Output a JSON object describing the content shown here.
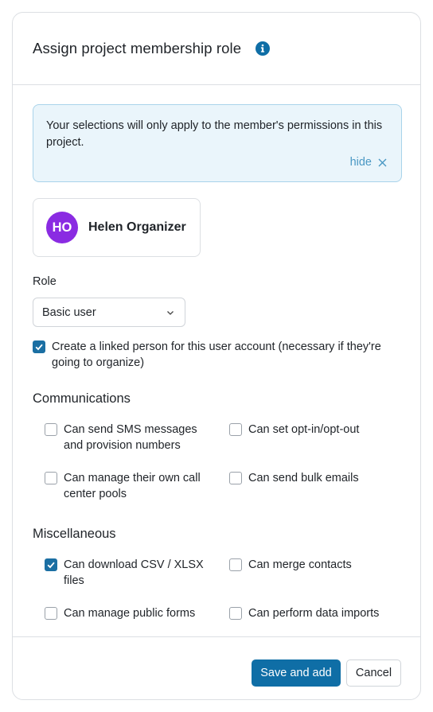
{
  "dialog": {
    "title": "Assign project membership role",
    "info_icon": "info-icon"
  },
  "notice": {
    "text": "Your selections will only apply to the member's permissions in this project.",
    "hide_label": "hide"
  },
  "member": {
    "initials": "HO",
    "name": "Helen Organizer",
    "avatar_color": "#8a2be2"
  },
  "role": {
    "label": "Role",
    "selected": "Basic user"
  },
  "linked_person": {
    "label": "Create a linked person for this user account (necessary if they're going to organize)",
    "checked": true
  },
  "communications": {
    "title": "Communications",
    "items": [
      {
        "label": "Can send SMS messages and provision numbers",
        "checked": false
      },
      {
        "label": "Can set opt-in/opt-out",
        "checked": false
      },
      {
        "label": "Can manage their own call center pools",
        "checked": false
      },
      {
        "label": "Can send bulk emails",
        "checked": false
      }
    ]
  },
  "miscellaneous": {
    "title": "Miscellaneous",
    "items": [
      {
        "label": "Can download CSV / XLSX files",
        "checked": true
      },
      {
        "label": "Can merge contacts",
        "checked": false
      },
      {
        "label": "Can manage public forms",
        "checked": false
      },
      {
        "label": "Can perform data imports",
        "checked": false
      }
    ]
  },
  "footer": {
    "save_label": "Save and add",
    "cancel_label": "Cancel"
  },
  "colors": {
    "accent": "#0f6ea6",
    "notice_bg": "#eaf5fb",
    "link": "#4a98c4"
  }
}
